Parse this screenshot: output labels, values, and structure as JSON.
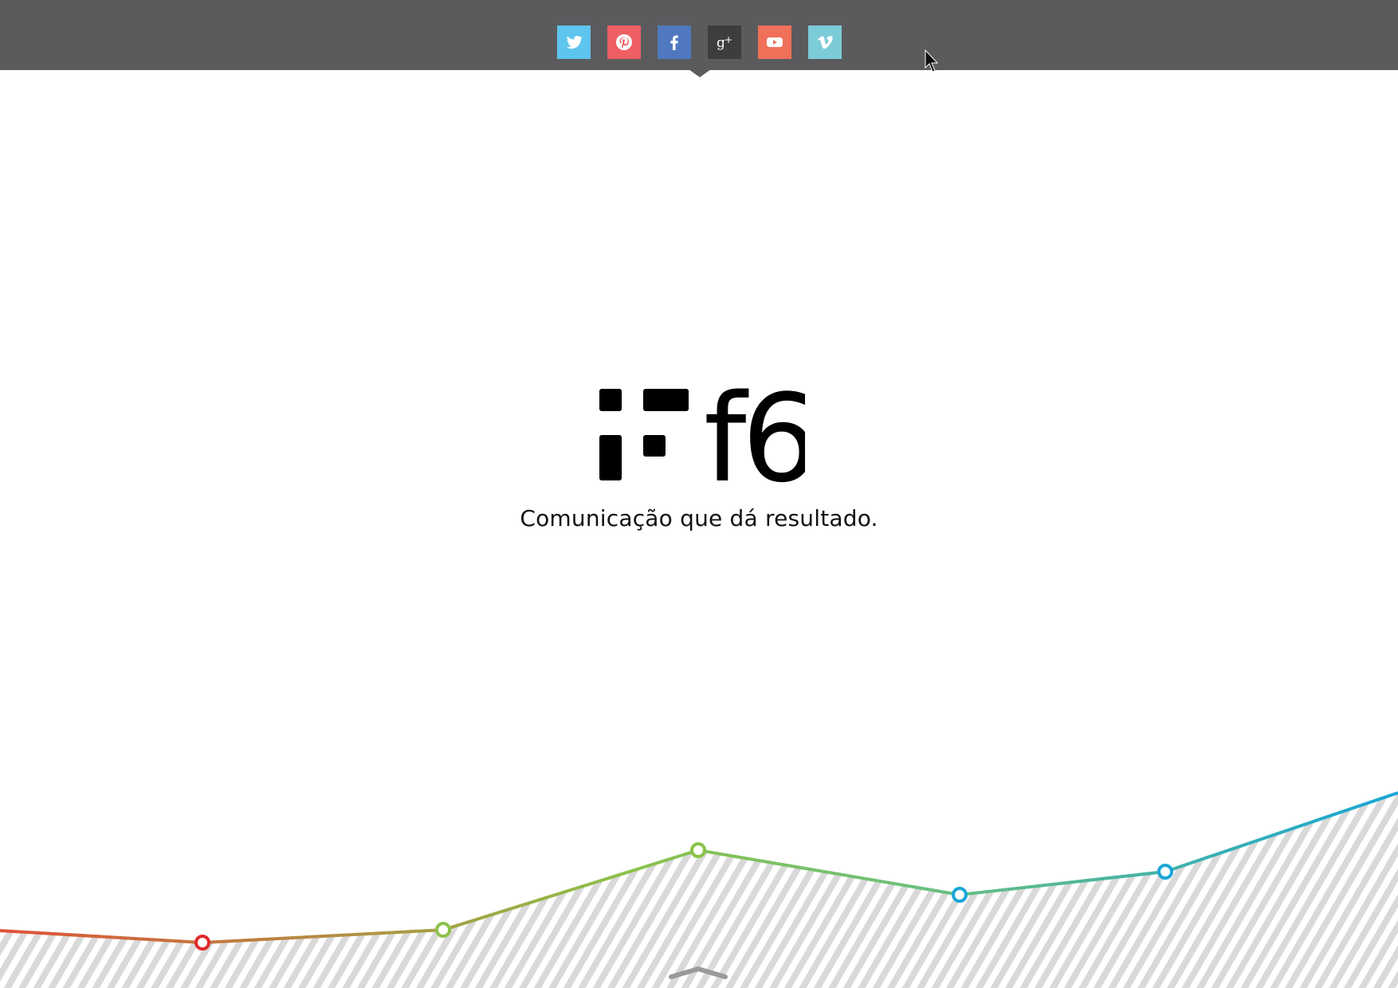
{
  "header": {
    "social_links": [
      {
        "name": "twitter",
        "icon": "twitter-icon",
        "color": "#5ec5ee"
      },
      {
        "name": "pinterest",
        "icon": "pinterest-icon",
        "color": "#ee5e62"
      },
      {
        "name": "facebook",
        "icon": "facebook-icon",
        "color": "#4f78c0"
      },
      {
        "name": "google-plus",
        "icon": "google-plus-icon",
        "color": "#3d3d3f"
      },
      {
        "name": "youtube",
        "icon": "youtube-icon",
        "color": "#f0705a"
      },
      {
        "name": "vimeo",
        "icon": "vimeo-icon",
        "color": "#7ccbd8"
      }
    ],
    "bar_color": "#5b5b5d"
  },
  "hero": {
    "logo_text": "f6",
    "tagline": "Comunicação que dá resultado."
  },
  "decorative_chart": {
    "stroke_gradient": [
      "#e0523a",
      "#8cc24a",
      "#6ec07a",
      "#1aa6d6"
    ],
    "marker_colors": [
      "#e02a2a",
      "#8cc24a",
      "#8cc24a",
      "#1aa6d6",
      "#1aa6d6"
    ],
    "hatch_color": "#d9d9d9"
  }
}
